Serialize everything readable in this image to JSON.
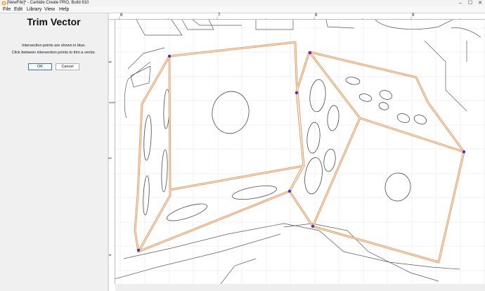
{
  "window": {
    "title": "[NewFile]* - Carbide Create PRO, Build 810",
    "minimize": "–",
    "maximize": "☐",
    "close": "✕"
  },
  "menu": [
    "File",
    "Edit",
    "Library",
    "View",
    "Help"
  ],
  "panel": {
    "title": "Trim Vector",
    "line1": "Intersection points are shown in blue.",
    "line2": "Click between intersection points to trim a vector.",
    "ok_label": "OK",
    "cancel_label": "Cancel"
  },
  "ruler": {
    "top_labels": [
      "6",
      "7",
      "8",
      "9"
    ],
    "left_labels": [
      "6",
      "5",
      "4"
    ]
  },
  "colors": {
    "selected_vector": "#e5a06a",
    "intersection_point": "#5b2bbf",
    "vector": "#5a5a5a",
    "grid": "#e6e6e6"
  }
}
